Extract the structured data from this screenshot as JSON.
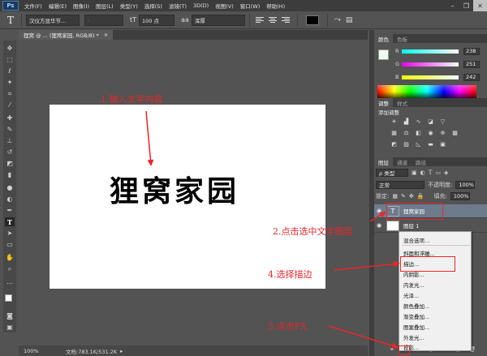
{
  "menubar": {
    "logo": "Ps",
    "items": [
      "文件(F)",
      "编辑(E)",
      "图像(I)",
      "图层(L)",
      "类型(Y)",
      "选择(S)",
      "滤镜(T)",
      "3D(D)",
      "视图(V)",
      "窗口(W)",
      "帮助(H)"
    ],
    "minimize": "–",
    "restore": "❐",
    "close": "✕"
  },
  "options": {
    "tool_glyph": "T",
    "font_family": "汉仪方显华节...",
    "font_style": "-",
    "size_glyph": "tT",
    "font_size": "100 点",
    "aa_glyph": "aa",
    "antialias": "浑厚",
    "text_color": "#000000"
  },
  "document_tab": {
    "label": "狸窝 @ ... (狸窝家园, RGB/8) *",
    "close": "×"
  },
  "canvas": {
    "text": "狸窝家园"
  },
  "statusbar": {
    "zoom": "100%",
    "doc_info": "文档:783.1K/531.2K"
  },
  "color_panel": {
    "tabs": [
      "颜色",
      "色板"
    ],
    "r_label": "R",
    "g_label": "G",
    "b_label": "B",
    "r": "238",
    "g": "251",
    "b": "242",
    "foreground": "#eefbf2"
  },
  "adjust_panel": {
    "tabs": [
      "调整",
      "样式"
    ],
    "title": "添加调整"
  },
  "layers_panel": {
    "tabs": [
      "图层",
      "通道",
      "路径"
    ],
    "filter": "ρ 类型",
    "blend_mode": "正常",
    "opacity_label": "不透明度:",
    "opacity": "100%",
    "lock_label": "锁定:",
    "fill_label": "填充:",
    "fill": "100%",
    "layers": [
      {
        "name": "狸窝家园",
        "type": "text",
        "selected": true
      },
      {
        "name": "图层 1",
        "type": "raster",
        "selected": false
      }
    ]
  },
  "context_menu": {
    "items": [
      "混合选项...",
      "斜面和浮雕...",
      "描边...",
      "内阴影...",
      "内发光...",
      "光泽...",
      "颜色叠加...",
      "渐变叠加...",
      "图案叠加...",
      "外发光...",
      "投影..."
    ]
  },
  "annotations": {
    "step1": "1.输入文字内容",
    "step2": "2.点击选中文字图层",
    "step3": "3.点击FX",
    "step4": "4.选择描边",
    "color": "#e8272a"
  }
}
